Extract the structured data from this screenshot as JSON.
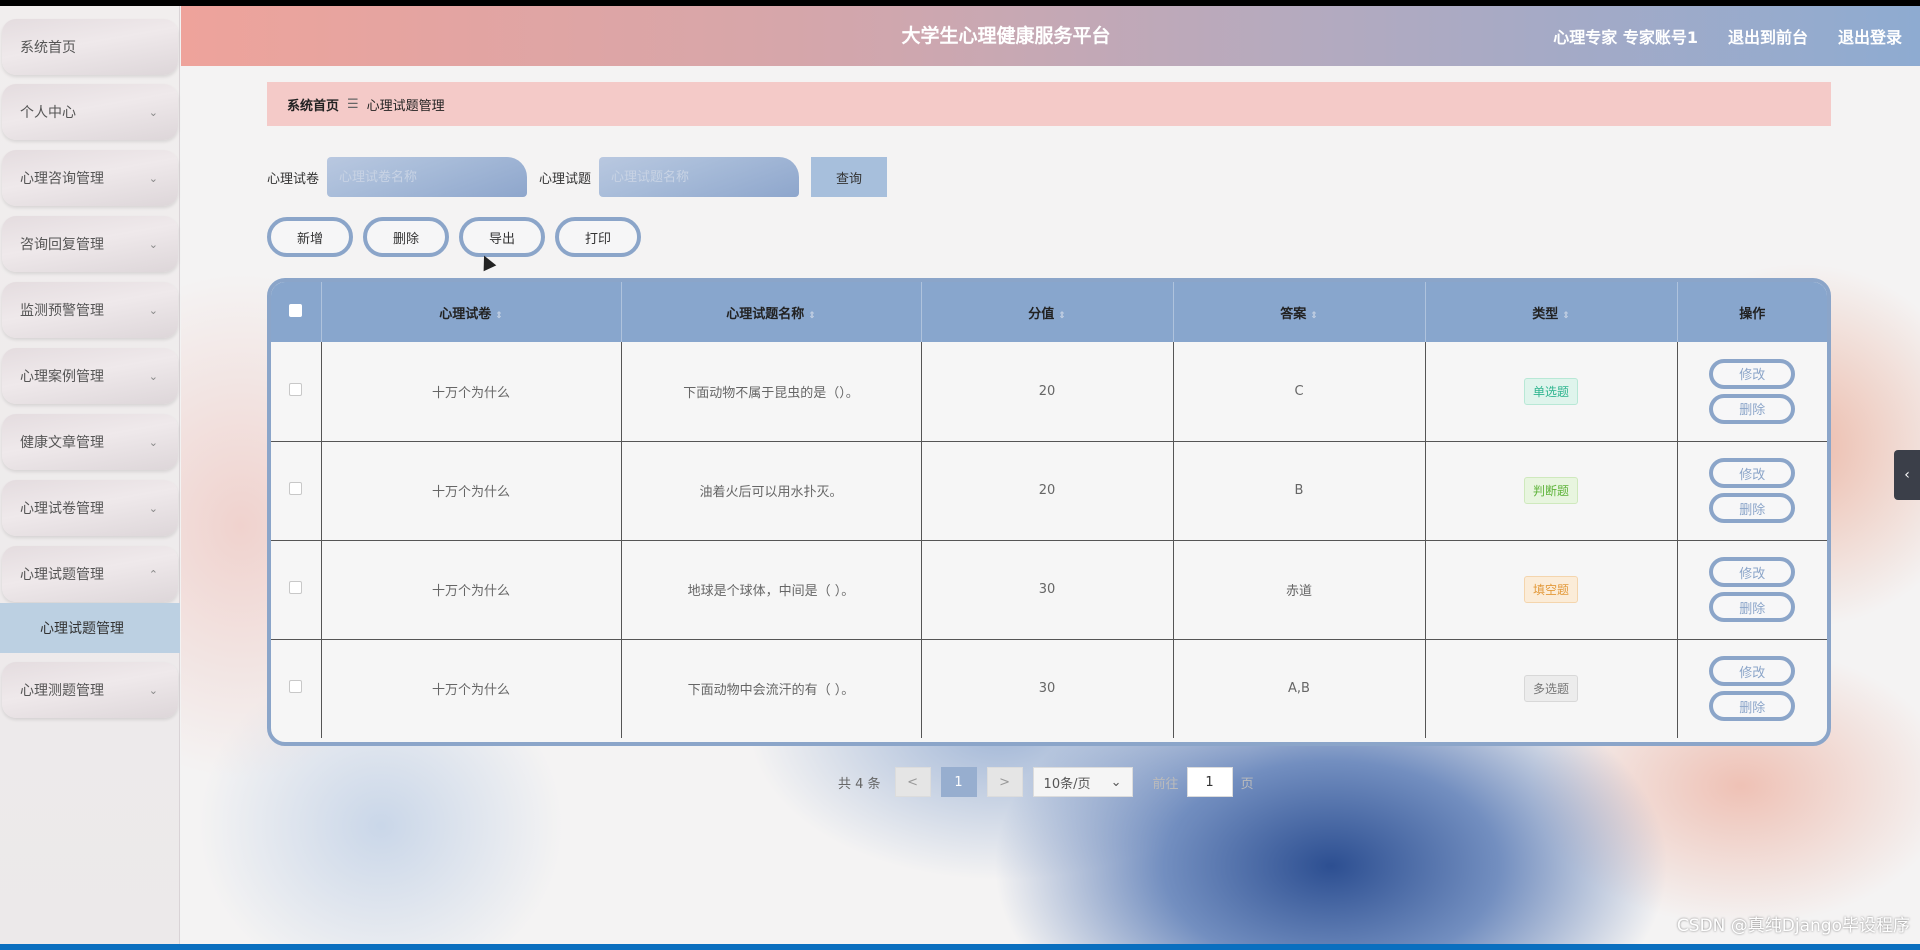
{
  "header": {
    "title": "大学生心理健康服务平台",
    "user": "心理专家 专家账号1",
    "to_front": "退出到前台",
    "logout": "退出登录"
  },
  "sidebar": {
    "items": [
      {
        "label": "系统首页",
        "chev": ""
      },
      {
        "label": "个人中心",
        "chev": "⌄"
      },
      {
        "label": "心理咨询管理",
        "chev": "⌄"
      },
      {
        "label": "咨询回复管理",
        "chev": "⌄"
      },
      {
        "label": "监测预警管理",
        "chev": "⌄"
      },
      {
        "label": "心理案例管理",
        "chev": "⌄"
      },
      {
        "label": "健康文章管理",
        "chev": "⌄"
      },
      {
        "label": "心理试卷管理",
        "chev": "⌄"
      },
      {
        "label": "心理试题管理",
        "chev": "⌃"
      },
      {
        "label": "心理测题管理",
        "chev": "⌄"
      }
    ],
    "sub_active": "心理试题管理"
  },
  "breadcrumb": {
    "home": "系统首页",
    "sep": "☰",
    "current": "心理试题管理"
  },
  "search": {
    "paper_label": "心理试卷",
    "paper_placeholder": "心理试卷名称",
    "question_label": "心理试题",
    "question_placeholder": "心理试题名称",
    "query_label": "查询"
  },
  "actions": {
    "add": "新增",
    "delete": "删除",
    "export": "导出",
    "print": "打印"
  },
  "table": {
    "columns": [
      "心理试卷",
      "心理试题名称",
      "分值",
      "答案",
      "类型",
      "操作"
    ],
    "sort_glyph": "⇕",
    "rows": [
      {
        "paper": "十万个为什么",
        "question": "下面动物不属于昆虫的是（）。",
        "score": "20",
        "answer": "C",
        "type": "单选题",
        "type_class": "tag-single"
      },
      {
        "paper": "十万个为什么",
        "question": "油着火后可以用水扑灭。",
        "score": "20",
        "answer": "B",
        "type": "判断题",
        "type_class": "tag-judge"
      },
      {
        "paper": "十万个为什么",
        "question": "地球是个球体，中间是（ ）。",
        "score": "30",
        "answer": "赤道",
        "type": "填空题",
        "type_class": "tag-fill"
      },
      {
        "paper": "十万个为什么",
        "question": "下面动物中会流汗的有（ ）。",
        "score": "30",
        "answer": "A,B",
        "type": "多选题",
        "type_class": "tag-multi"
      }
    ],
    "edit_label": "修改",
    "delete_label": "删除"
  },
  "pagination": {
    "total": "共 4 条",
    "prev": "<",
    "page": "1",
    "next": ">",
    "page_size": "10条/页",
    "goto_prefix": "前往",
    "goto_value": "1",
    "goto_suffix": "页"
  },
  "watermark": "CSDN @真纯Django毕设程序",
  "colors": {
    "accent": "#8ba5c9",
    "header_start": "#eea39b",
    "header_end": "#8eabd1",
    "breadcrumb_bg": "#f4cac8"
  }
}
